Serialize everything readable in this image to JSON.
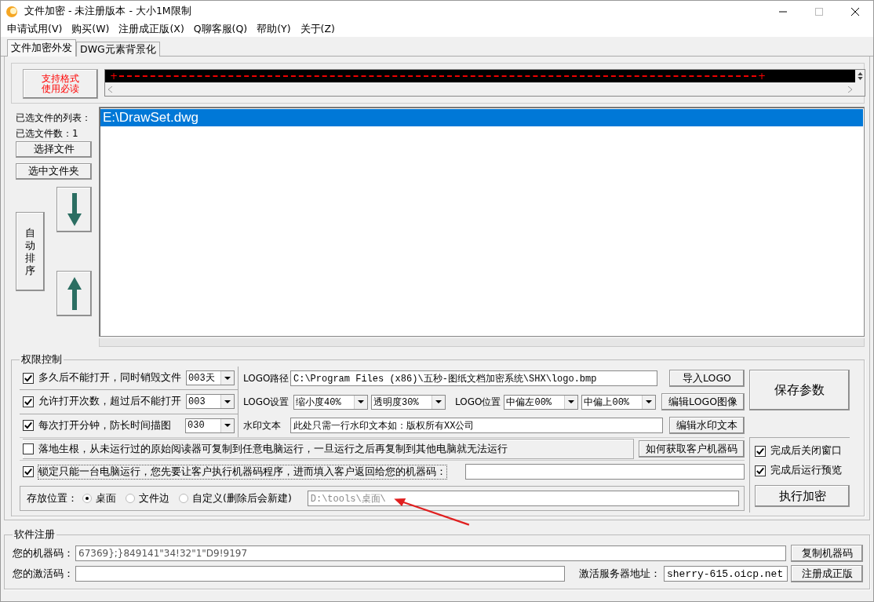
{
  "window": {
    "title": "文件加密 - 未注册版本 - 大小1M限制"
  },
  "menu": [
    "申请试用(V)",
    "购买(W)",
    "注册成正版(X)",
    "Q聊客服(Q)",
    "帮助(Y)",
    "关于(Z)"
  ],
  "tabs": [
    {
      "label": "文件加密外发",
      "selected": true
    },
    {
      "label": "DWG元素背景化",
      "selected": false
    }
  ],
  "format_button": {
    "lines": [
      "支持格式",
      "使用必读"
    ]
  },
  "marker_strip": {
    "start": "+",
    "end": "+"
  },
  "file_list": {
    "list_label": "已选文件的列表：",
    "count_label": "已选文件数：1",
    "select_file_button": "选择文件",
    "select_folder_button": "选中文件夹",
    "auto_sort_button": "自动排序",
    "files": [
      {
        "path": "E:\\DrawSet.dwg",
        "selected": true
      }
    ]
  },
  "permissions": {
    "title": "权限控制",
    "rules": [
      {
        "label": "多久后不能打开，同时销毁文件",
        "checked": true,
        "value": "003天"
      },
      {
        "label": "允许打开次数，超过后不能打开",
        "checked": true,
        "value": "003"
      },
      {
        "label": "每次打开分钟，防长时间描图",
        "checked": true,
        "value": "030"
      }
    ],
    "logo_path": {
      "label": "LOGO路径",
      "value": "C:\\Program Files (x86)\\五秒-图纸文档加密系统\\SHX\\logo.bmp",
      "button": "导入LOGO"
    },
    "logo_settings": {
      "label": "LOGO设置",
      "scale": "缩小度40%",
      "opacity": "透明度30%",
      "position_label": "LOGO位置",
      "horizontal": "中偏左00%",
      "vertical": "中偏上00%",
      "button": "编辑LOGO图像"
    },
    "watermark": {
      "label": "水印文本",
      "value": "此处只需一行水印文本如：版权所有XX公司",
      "button": "编辑水印文本"
    },
    "root_option": {
      "label": "落地生根，从未运行过的原始阅读器可复制到任意电脑运行，一旦运行之后再复制到其他电脑就无法运行",
      "checked": false,
      "button": "如何获取客户机器码"
    },
    "lock_option": {
      "label": "锁定只能一台电脑运行，您先要让客户执行机器码程序，进而填入客户返回给您的机器码：",
      "checked": true
    },
    "storage": {
      "label": "存放位置：",
      "options": [
        {
          "label": "桌面",
          "selected": true
        },
        {
          "label": "文件边",
          "selected": false
        },
        {
          "label": "自定义(删除后会新建)",
          "selected": false
        }
      ],
      "path": "D:\\tools\\桌面\\"
    },
    "save_button": "保存参数",
    "after_options": [
      {
        "label": "完成后关闭窗口",
        "checked": true
      },
      {
        "label": "完成后运行预览",
        "checked": true
      }
    ],
    "run_button": "执行加密"
  },
  "registration": {
    "title": "软件注册",
    "machine_label": "您的机器码：",
    "machine_code": "67369};}849141\"34!32\"1\"D9!9197",
    "copy_button": "复制机器码",
    "activation_label": "您的激活码：",
    "server_label": "激活服务器地址：",
    "server": "sherry-615.oicp.net",
    "register_button": "注册成正版"
  }
}
